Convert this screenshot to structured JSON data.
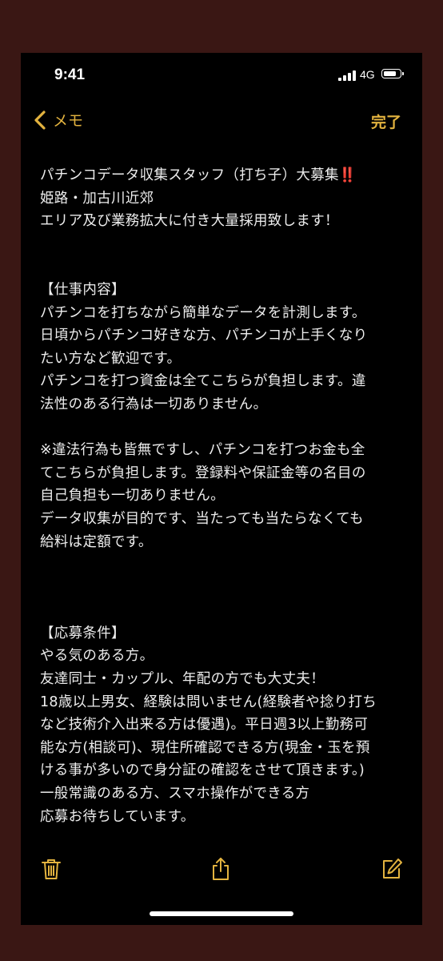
{
  "status_bar": {
    "time": "9:41",
    "network": "4G",
    "battery_level": 0.8
  },
  "nav": {
    "back_label": "メモ",
    "done_label": "完了"
  },
  "note": {
    "lines": [
      "パチンコデータ収集スタッフ（打ち子）大募集‼️",
      "姫路・加古川近郊",
      "エリア及び業務拡大に付き大量採用致します！",
      "",
      "",
      "【仕事内容】",
      "パチンコを打ちながら簡単なデータを計測します。",
      "日頃からパチンコ好きな方、パチンコが上手くなり",
      "たい方など歓迎です。",
      "パチンコを打つ資金は全てこちらが負担します。違",
      "法性のある行為は一切ありません。",
      "",
      "※違法行為も皆無ですし、パチンコを打つお金も全",
      "てこちらが負担します。登録料や保証金等の名目の",
      "自己負担も一切ありません。",
      "データ収集が目的です、当たっても当たらなくても",
      "給料は定額です。",
      "",
      "",
      "",
      "【応募条件】",
      "やる気のある方。",
      "友達同士・カップル、年配の方でも大丈夫！",
      "18歳以上男女、経験は問いません(経験者や捻り打ち",
      "など技術介入出来る方は優遇)。平日週3以上勤務可",
      "能な方(相談可)、現住所確認できる方(現金・玉を預",
      "ける事が多いので身分証の確認をさせて頂きます。)",
      "一般常識のある方、スマホ操作ができる方",
      "応募お待ちしています。"
    ]
  },
  "toolbar": {
    "icons": [
      "trash-icon",
      "share-icon",
      "compose-icon"
    ]
  },
  "colors": {
    "accent": "#e3b33f",
    "background": "#000000",
    "frame": "#3a1714",
    "text": "#ededed"
  }
}
